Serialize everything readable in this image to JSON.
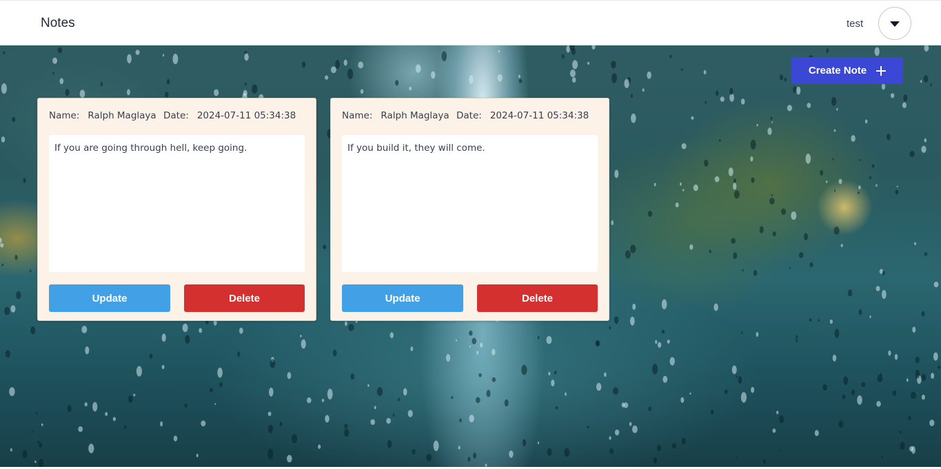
{
  "navbar": {
    "brand": "Notes",
    "username": "test"
  },
  "actions": {
    "create_label": "Create Note"
  },
  "labels": {
    "name": "Name:",
    "date": "Date:",
    "update": "Update",
    "delete": "Delete"
  },
  "notes": [
    {
      "name": "Ralph Maglaya",
      "date": "2024-07-11 05:34:38",
      "content": "If you are going through hell, keep going."
    },
    {
      "name": "Ralph Maglaya",
      "date": "2024-07-11 05:34:38",
      "content": "If you build it, they will come."
    }
  ],
  "colors": {
    "primary": "#3b48d6",
    "update": "#42a1e6",
    "delete": "#d3302f",
    "card": "#fdf2e7"
  }
}
